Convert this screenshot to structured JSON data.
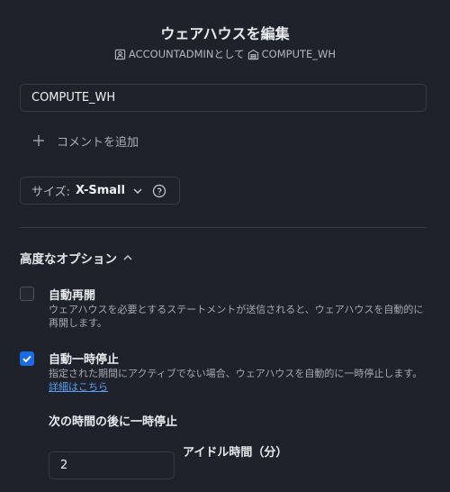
{
  "dialog": {
    "title": "ウェアハウスを編集",
    "role": "ACCOUNTADMIN",
    "role_suffix": "として",
    "warehouse": "COMPUTE_WH"
  },
  "name_field": {
    "value": "COMPUTE_WH"
  },
  "comment": {
    "label": "コメントを追加"
  },
  "size": {
    "label": "サイズ:",
    "value": "X-Small"
  },
  "advanced": {
    "label": "高度なオプション",
    "auto_resume": {
      "checked": false,
      "title": "自動再開",
      "description": "ウェアハウスを必要とするステートメントが送信されると、ウェアハウスを自動的に再開します。"
    },
    "auto_suspend": {
      "checked": true,
      "title": "自動一時停止",
      "description": "指定された期間にアクティブでない場合、ウェアハウスを自動的に一時停止します。",
      "link": "詳細はこちら"
    },
    "suspend_after": {
      "label": "次の時間の後に一時停止",
      "value": "2",
      "unit": "アイドル時間（分）"
    }
  },
  "colors": {
    "background": "#1e232b",
    "accent": "#1a6ce6",
    "link": "#5b9cf2"
  }
}
